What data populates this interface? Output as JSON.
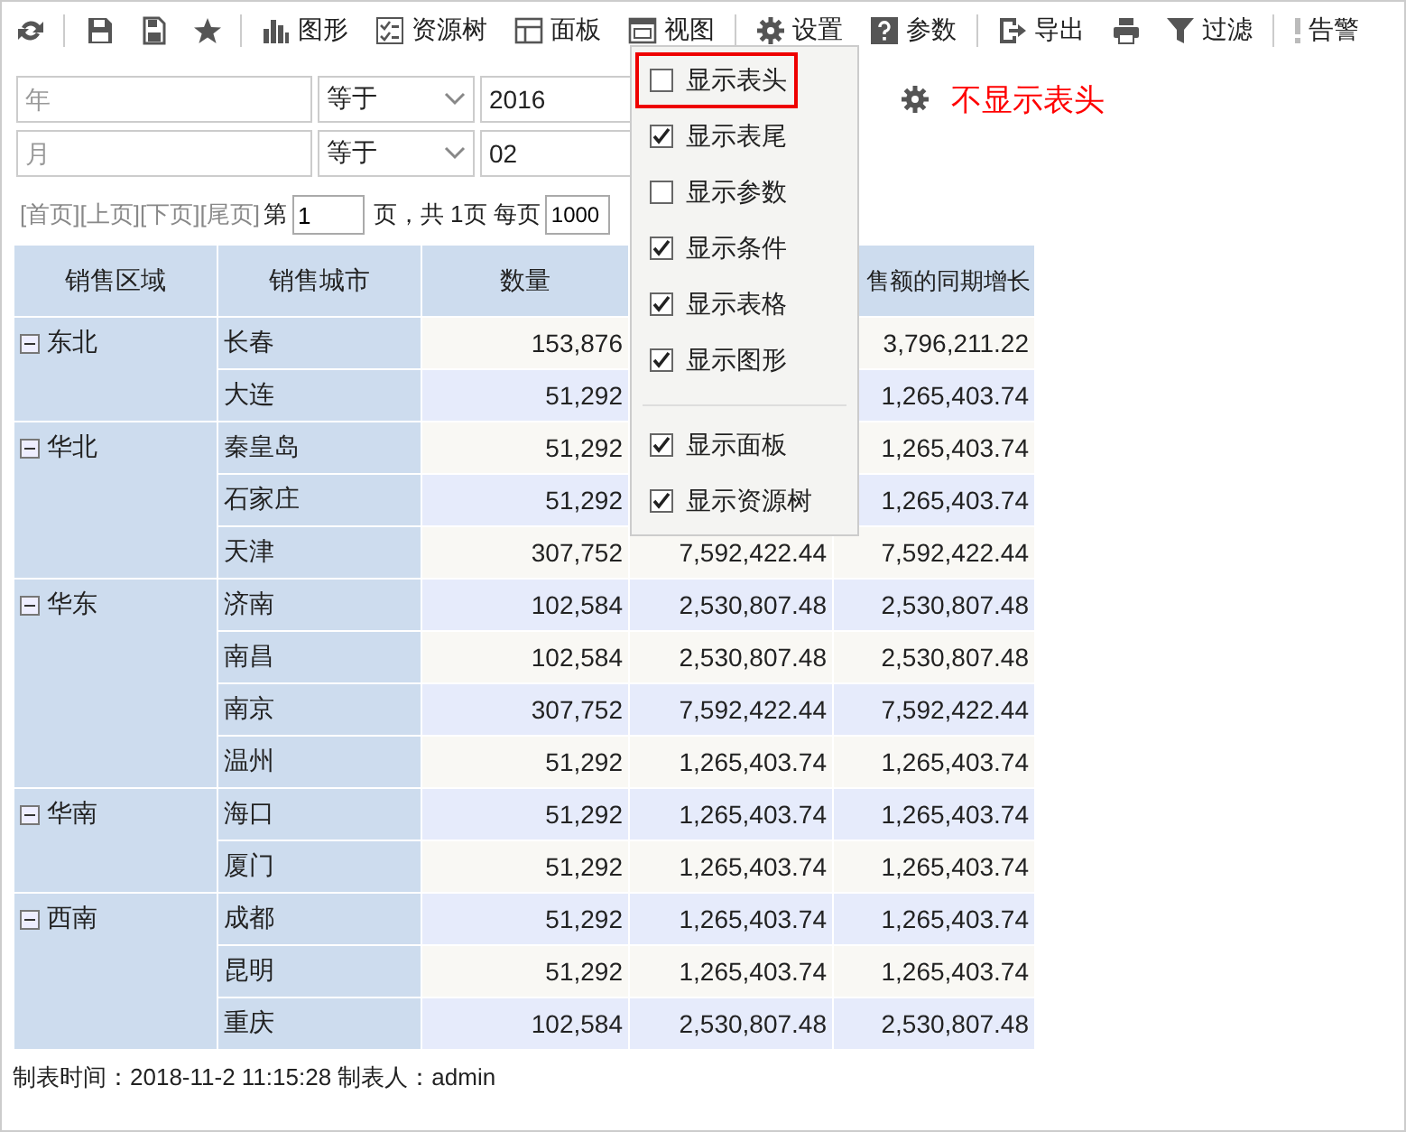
{
  "toolbar": [
    {
      "kind": "icon"
    },
    {
      "kind": "separator"
    },
    {
      "kind": "icon"
    },
    {
      "kind": "icon"
    },
    {
      "kind": "icon"
    },
    {
      "kind": "separator"
    },
    {
      "kind": "labeled",
      "label": "图形"
    },
    {
      "kind": "labeled",
      "label": "资源树"
    },
    {
      "kind": "labeled",
      "label": "面板"
    },
    {
      "kind": "labeled",
      "label": "视图"
    },
    {
      "kind": "separator"
    },
    {
      "kind": "labeled",
      "label": "设置"
    },
    {
      "kind": "labeled",
      "label": "参数"
    },
    {
      "kind": "separator"
    },
    {
      "kind": "labeled",
      "label": "导出"
    },
    {
      "kind": "icon"
    },
    {
      "kind": "labeled",
      "label": "过滤"
    },
    {
      "kind": "separator"
    },
    {
      "kind": "labeled",
      "label": "告警"
    }
  ],
  "conditions": [
    {
      "field": {
        "placeholder": "年"
      },
      "operator": "等于",
      "value": "2016"
    },
    {
      "field": {
        "placeholder": "月"
      },
      "operator": "等于",
      "value": "02"
    }
  ],
  "annotation": {
    "text": "不显示表头"
  },
  "pager": {
    "links": [
      "[首页]",
      "[上页]",
      "[下页]",
      "[尾页]"
    ],
    "prefix": "第",
    "page": "1",
    "middle": "页，共 1页 每页",
    "page_size": "1000"
  },
  "table": {
    "columns": [
      "销售区域",
      "销售城市",
      "数量",
      "售额的同期增长"
    ],
    "regions": [
      {
        "name": "东北",
        "expanded": true,
        "rows": [
          [
            "长春",
            "153,876",
            null,
            "3,796,211.22"
          ],
          [
            "大连",
            "51,292",
            null,
            "1,265,403.74"
          ]
        ]
      },
      {
        "name": "华北",
        "expanded": true,
        "rows": [
          [
            "秦皇岛",
            "51,292",
            null,
            "1,265,403.74"
          ],
          [
            "石家庄",
            "51,292",
            null,
            "1,265,403.74"
          ],
          [
            "天津",
            "307,752",
            "7,592,422.44",
            "7,592,422.44"
          ]
        ]
      },
      {
        "name": "华东",
        "expanded": true,
        "rows": [
          [
            "济南",
            "102,584",
            "2,530,807.48",
            "2,530,807.48"
          ],
          [
            "南昌",
            "102,584",
            "2,530,807.48",
            "2,530,807.48"
          ],
          [
            "南京",
            "307,752",
            "7,592,422.44",
            "7,592,422.44"
          ],
          [
            "温州",
            "51,292",
            "1,265,403.74",
            "1,265,403.74"
          ]
        ]
      },
      {
        "name": "华南",
        "expanded": true,
        "rows": [
          [
            "海口",
            "51,292",
            "1,265,403.74",
            "1,265,403.74"
          ],
          [
            "厦门",
            "51,292",
            "1,265,403.74",
            "1,265,403.74"
          ]
        ]
      },
      {
        "name": "西南",
        "expanded": true,
        "rows": [
          [
            "成都",
            "51,292",
            "1,265,403.74",
            "1,265,403.74"
          ],
          [
            "昆明",
            "51,292",
            "1,265,403.74",
            "1,265,403.74"
          ],
          [
            "重庆",
            "102,584",
            "2,530,807.48",
            "2,530,807.48"
          ]
        ]
      }
    ]
  },
  "footer": "制表时间：2018-11-2 11:15:28 制表人：admin",
  "view_menu": {
    "groups": [
      [
        {
          "label": "显示表头",
          "checked": false,
          "highlighted": true
        },
        {
          "label": "显示表尾",
          "checked": true,
          "highlighted": false
        },
        {
          "label": "显示参数",
          "checked": false,
          "highlighted": false
        },
        {
          "label": "显示条件",
          "checked": true,
          "highlighted": false
        },
        {
          "label": "显示表格",
          "checked": true,
          "highlighted": false
        },
        {
          "label": "显示图形",
          "checked": true,
          "highlighted": false
        }
      ],
      [
        {
          "label": "显示面板",
          "checked": true,
          "highlighted": false
        },
        {
          "label": "显示资源树",
          "checked": true,
          "highlighted": false
        }
      ]
    ]
  }
}
